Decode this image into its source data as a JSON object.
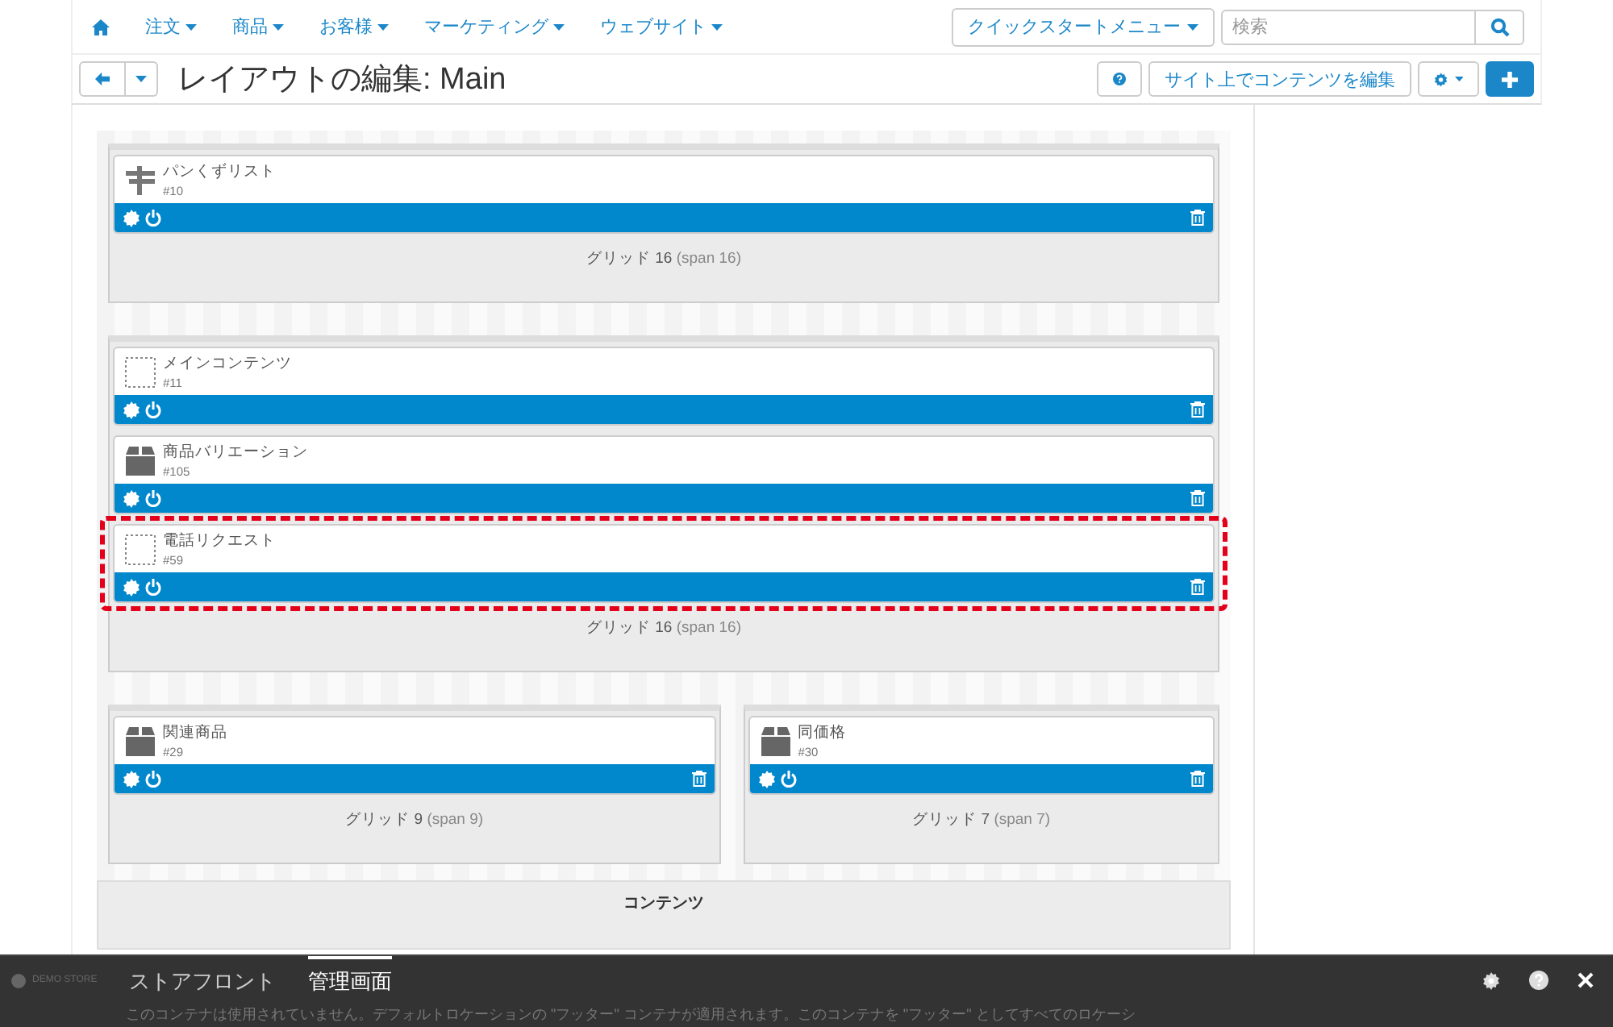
{
  "nav": {
    "menus": [
      {
        "label": "注文"
      },
      {
        "label": "商品"
      },
      {
        "label": "お客様"
      },
      {
        "label": "マーケティング"
      },
      {
        "label": "ウェブサイト"
      }
    ],
    "quickstart": "クイックスタートメニュー",
    "search": {
      "placeholder": "検索"
    }
  },
  "toolbar": {
    "title": "レイアウトの編集: Main",
    "edit_button": "サイト上でコンテンツを編集"
  },
  "rows": [
    {
      "grids": [
        {
          "title": "グリッド 16",
          "span": "(span 16)",
          "blocks": [
            {
              "kind": "signpost",
              "name": "パンくずリスト",
              "id": "#10",
              "highlighted": false
            }
          ]
        }
      ]
    },
    {
      "grids": [
        {
          "title": "グリッド 16",
          "span": "(span 16)",
          "blocks": [
            {
              "kind": "placeholder",
              "name": "メインコンテンツ",
              "id": "#11",
              "highlighted": false
            },
            {
              "kind": "box",
              "name": "商品バリエーション",
              "id": "#105",
              "highlighted": false
            },
            {
              "kind": "placeholder",
              "name": "電話リクエスト",
              "id": "#59",
              "highlighted": true
            }
          ]
        }
      ]
    },
    {
      "grids": [
        {
          "title": "グリッド 9",
          "span": "(span 9)",
          "blocks": [
            {
              "kind": "box",
              "name": "関連商品",
              "id": "#29",
              "highlighted": false
            }
          ]
        },
        {
          "title": "グリッド 7",
          "span": "(span 7)",
          "blocks": [
            {
              "kind": "box",
              "name": "同価格",
              "id": "#30",
              "highlighted": false
            }
          ]
        }
      ]
    }
  ],
  "container": {
    "title": "コンテンツ"
  },
  "bottom_bar": {
    "logo": "DEMO STORE",
    "tabs": [
      {
        "label": "ストアフロント",
        "selected": false
      },
      {
        "label": "管理画面",
        "selected": true
      }
    ],
    "notice": "このコンテナは使用されていません。デフォルトロケーションの \"フッター\" コンテナが適用されます。このコンテナを \"フッター\" としてすべてのロケーシ"
  }
}
